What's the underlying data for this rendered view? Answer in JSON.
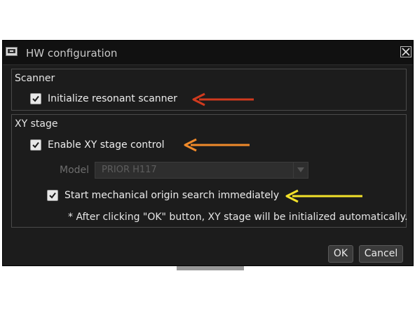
{
  "window": {
    "title": "HW configuration"
  },
  "scanner": {
    "group_title": "Scanner",
    "init_label": "Initialize resonant scanner",
    "init_checked": true
  },
  "xy_stage": {
    "group_title": "XY stage",
    "enable_label": "Enable XY stage control",
    "enable_checked": true,
    "model_label": "Model",
    "model_value": "PRIOR H117",
    "origin_label": "Start mechanical origin search immediately",
    "origin_checked": true,
    "note": "* After clicking \"OK\" button, XY stage will be initialized automatically."
  },
  "buttons": {
    "ok": "OK",
    "cancel": "Cancel"
  },
  "annotations": {
    "arrow_colors": [
      "#d03a1e",
      "#f08a2a",
      "#f2e12a"
    ]
  },
  "colors": {
    "dialog_bg": "#1c1c1c",
    "titlebar_bg": "#111111",
    "text": "#ededed",
    "disabled_text": "#6e6e6e"
  }
}
